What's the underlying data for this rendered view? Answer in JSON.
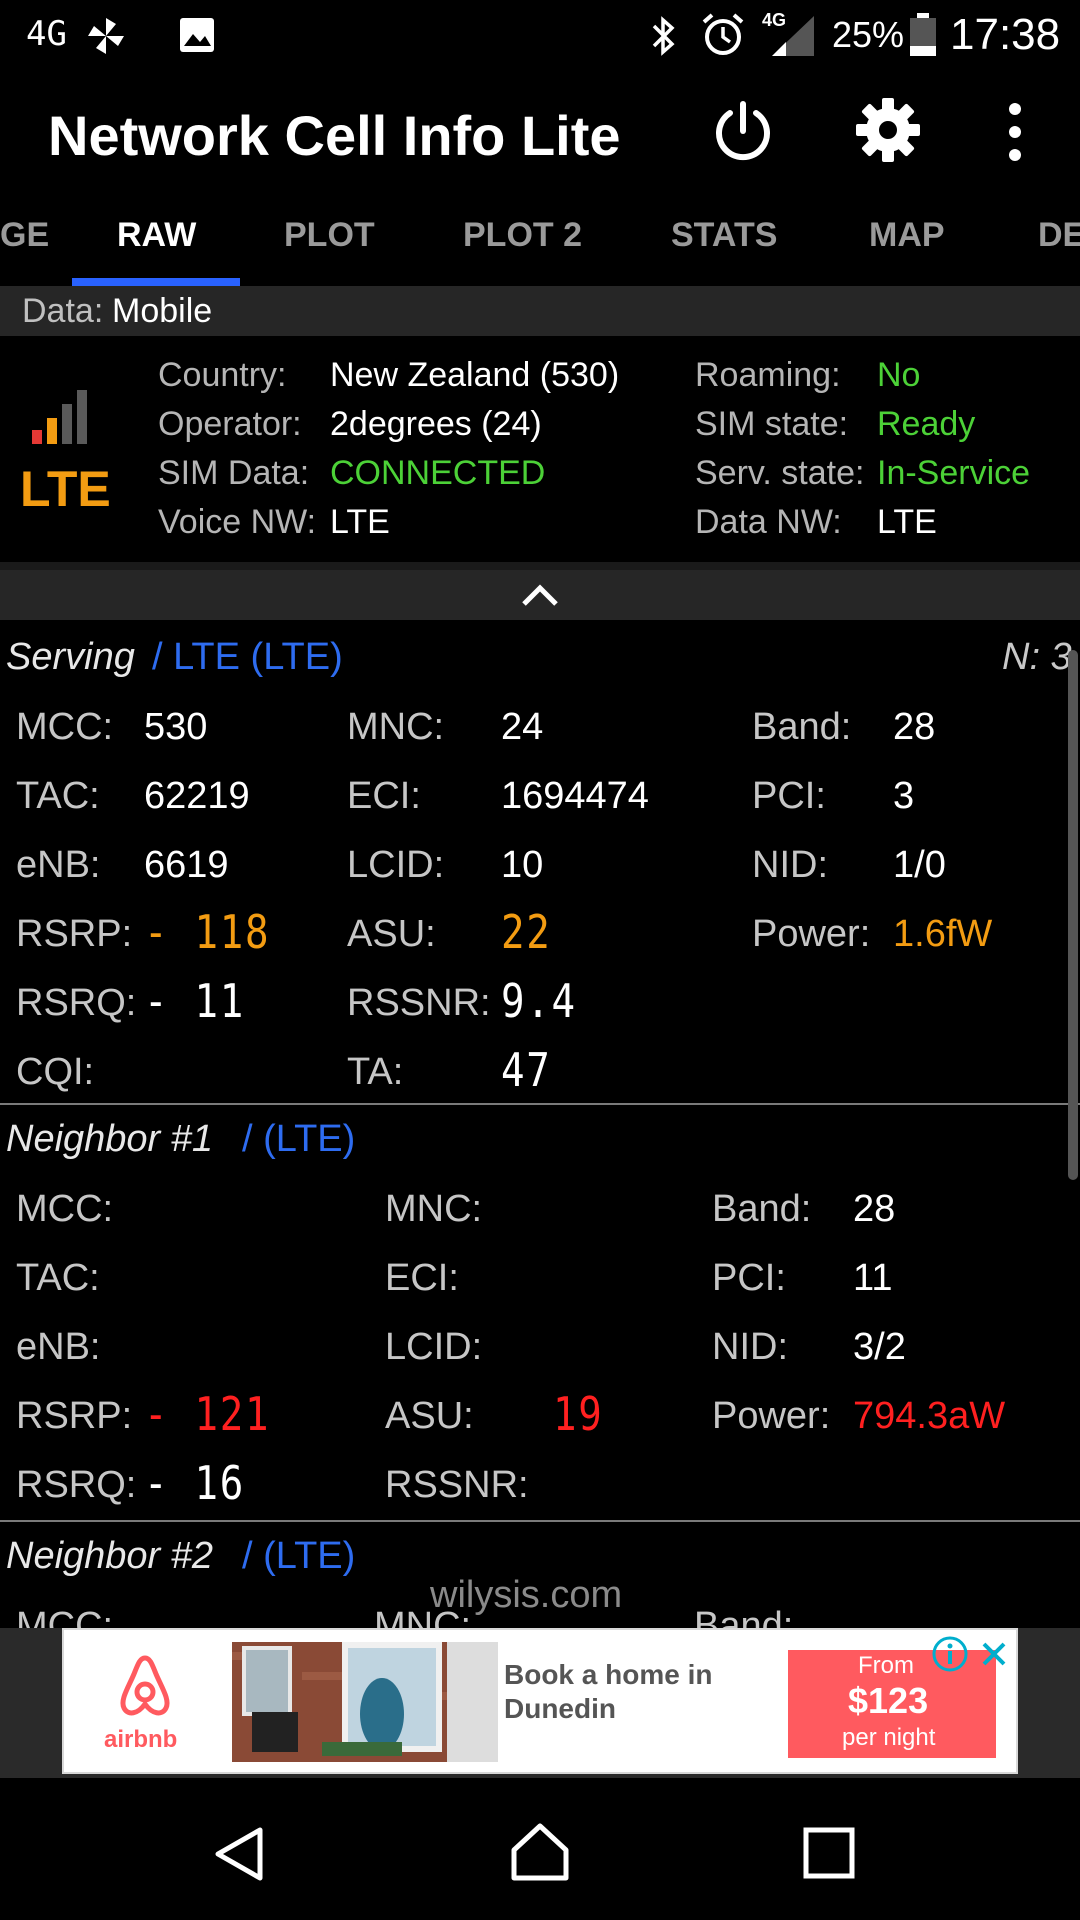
{
  "status_bar": {
    "network_left": "4G",
    "battery": "25%",
    "time": "17:38",
    "signal_type": "4G"
  },
  "app_bar": {
    "title": "Network Cell Info Lite",
    "power_icon": "power-icon",
    "settings_icon": "gear-icon",
    "menu_icon": "more-vertical-icon"
  },
  "tabs": [
    {
      "label": "GE"
    },
    {
      "label": "RAW"
    },
    {
      "label": "PLOT"
    },
    {
      "label": "PLOT 2"
    },
    {
      "label": "STATS"
    },
    {
      "label": "MAP"
    },
    {
      "label": "DE"
    }
  ],
  "data_bar": {
    "label": "Data:",
    "value": "Mobile"
  },
  "summary": {
    "tech": "LTE",
    "country_label": "Country:",
    "country": "New Zealand (530)",
    "operator_label": "Operator:",
    "operator": "2degrees (24)",
    "sim_data_label": "SIM Data:",
    "sim_data": "CONNECTED",
    "voice_nw_label": "Voice NW:",
    "voice_nw": "LTE",
    "roaming_label": "Roaming:",
    "roaming": "No",
    "sim_state_label": "SIM state:",
    "sim_state": "Ready",
    "serv_state_label": "Serv. state:",
    "serv_state": "In-Service",
    "data_nw_label": "Data NW:",
    "data_nw": "LTE"
  },
  "serving": {
    "title": "Serving",
    "tech": "/ LTE (LTE)",
    "n": "N: 3",
    "mcc_label": "MCC:",
    "mcc": "530",
    "mnc_label": "MNC:",
    "mnc": "24",
    "band_label": "Band:",
    "band": "28",
    "tac_label": "TAC:",
    "tac": "62219",
    "eci_label": "ECI:",
    "eci": "1694474",
    "pci_label": "PCI:",
    "pci": "3",
    "enb_label": "eNB:",
    "enb": "6619",
    "lcid_label": "LCID:",
    "lcid": "10",
    "nid_label": "NID:",
    "nid": "1/0",
    "rsrp_label": "RSRP:",
    "rsrp": "- 118",
    "asu_label": "ASU:",
    "asu": "22",
    "power_label": "Power:",
    "power": "1.6fW",
    "rsrq_label": "RSRQ:",
    "rsrq": "- 11",
    "rssnr_label": "RSSNR:",
    "rssnr": "9.4",
    "cqi_label": "CQI:",
    "ta_label": "TA:",
    "ta": "47"
  },
  "neighbor1": {
    "title": "Neighbor #1",
    "tech": "/ (LTE)",
    "mcc_label": "MCC:",
    "mnc_label": "MNC:",
    "band_label": "Band:",
    "band": "28",
    "tac_label": "TAC:",
    "eci_label": "ECI:",
    "pci_label": "PCI:",
    "pci": "11",
    "enb_label": "eNB:",
    "lcid_label": "LCID:",
    "nid_label": "NID:",
    "nid": "3/2",
    "rsrp_label": "RSRP:",
    "rsrp": "- 121",
    "asu_label": "ASU:",
    "asu": "19",
    "power_label": "Power:",
    "power": "794.3aW",
    "rsrq_label": "RSRQ:",
    "rsrq": "- 16",
    "rssnr_label": "RSSNR:"
  },
  "neighbor2": {
    "title": "Neighbor #2",
    "tech": "/ (LTE)",
    "mcc_label": "MCC:",
    "mnc_label": "MNC:",
    "band_label": "Band:"
  },
  "watermark": "wilysis.com",
  "ad": {
    "brand": "airbnb",
    "headline": "Book a home in Dunedin",
    "from": "From",
    "price": "$123",
    "per": "per night",
    "info_icon": "info-icon",
    "close_icon": "close-icon"
  },
  "nav": {
    "back_icon": "back-triangle-icon",
    "home_icon": "home-icon",
    "recents_icon": "recents-square-icon"
  }
}
